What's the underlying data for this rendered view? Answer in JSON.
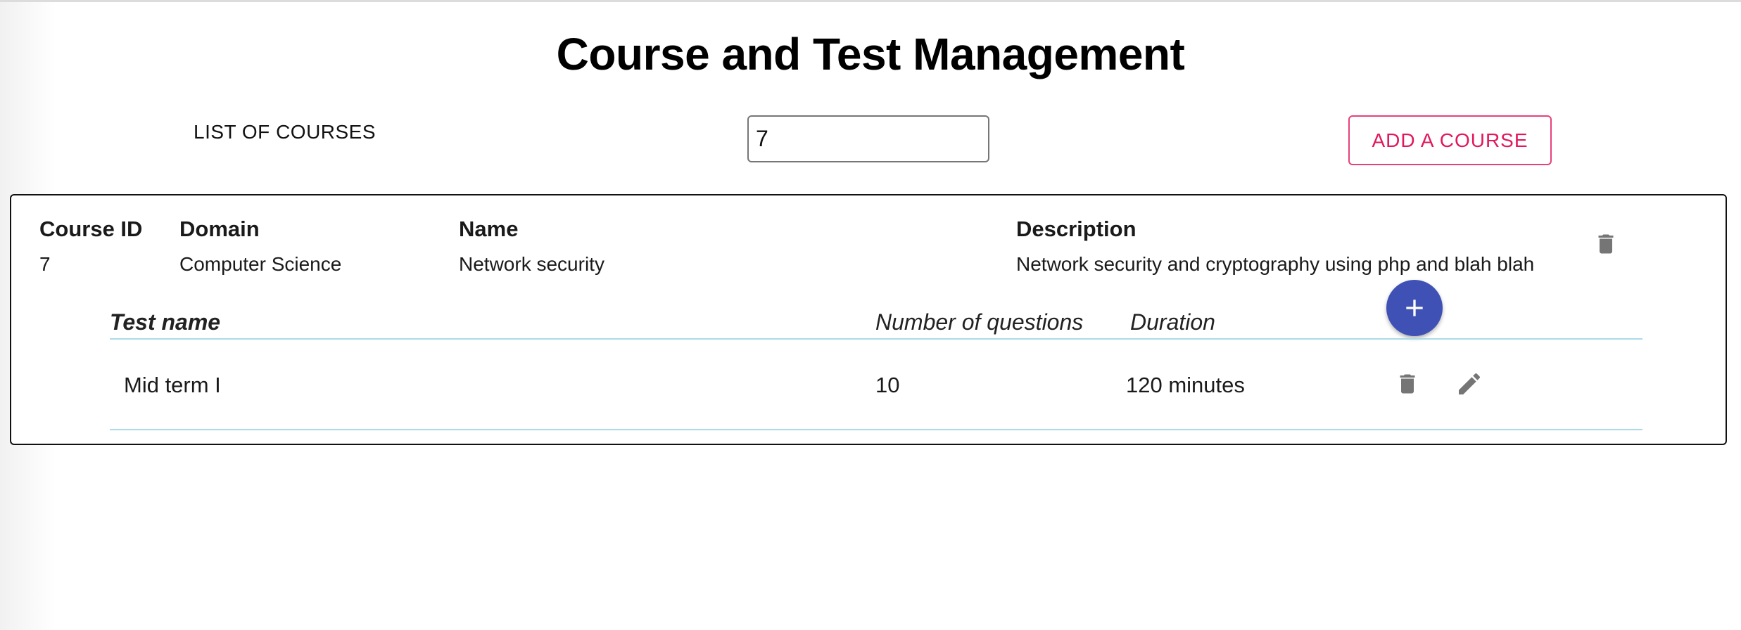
{
  "header": {
    "title": "Course and Test Management",
    "list_label": "LIST OF COURSES",
    "course_filter_value": "7",
    "add_course_label": "ADD A COURSE"
  },
  "course": {
    "headers": {
      "id": "Course ID",
      "domain": "Domain",
      "name": "Name",
      "description": "Description"
    },
    "id": "7",
    "domain": "Computer Science",
    "name": "Network security",
    "description": "Network security and cryptography using php and blah blah",
    "delete_icon": "trash-icon"
  },
  "tests": {
    "add_icon": "plus-icon",
    "headers": {
      "name": "Test name",
      "questions": "Number of questions",
      "duration": "Duration"
    },
    "rows": [
      {
        "name": "Mid term I",
        "questions": "10",
        "duration": "120 minutes",
        "delete_icon": "trash-icon",
        "edit_icon": "pencil-icon"
      }
    ]
  },
  "colors": {
    "accent_pink": "#e2185b",
    "fab_blue": "#3f51b5",
    "rule_blue": "#a9dbe9",
    "icon_gray": "#757575"
  }
}
